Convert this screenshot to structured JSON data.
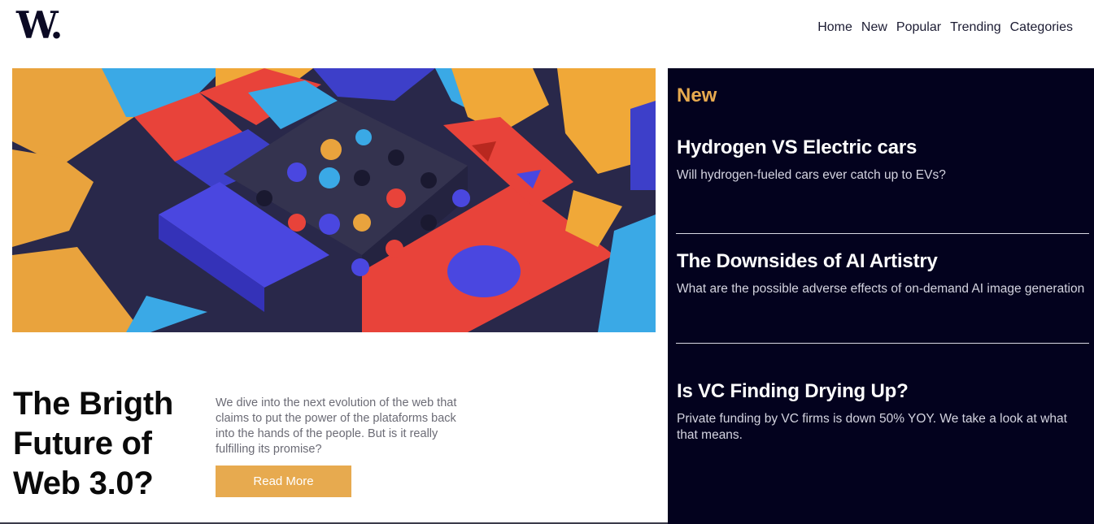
{
  "header": {
    "logo": "W.",
    "nav": [
      "Home",
      "New",
      "Popular",
      "Trending",
      "Categories"
    ]
  },
  "hero": {
    "title": "The Brigth Future of Web 3.0?",
    "description": "We dive into the next evolution of the web that claims to put the power of the plataforms back into the hands of the people. But is it really fulfilling its promise?",
    "button_label": "Read More"
  },
  "sidebar": {
    "heading": "New",
    "items": [
      {
        "title": "Hydrogen VS Electric cars",
        "summary": "Will hydrogen-fueled cars ever catch up to EVs?"
      },
      {
        "title": "The Downsides of AI Artistry",
        "summary": "What are the possible adverse effects of on-demand AI image generation"
      },
      {
        "title": "Is VC Finding Drying Up?",
        "summary": "Private funding by VC firms is down 50% YOY. We take a look at what that means."
      }
    ]
  },
  "colors": {
    "accent": "#e7aa4f",
    "sidebar_bg": "#03021e",
    "logo": "#0b0a24"
  }
}
